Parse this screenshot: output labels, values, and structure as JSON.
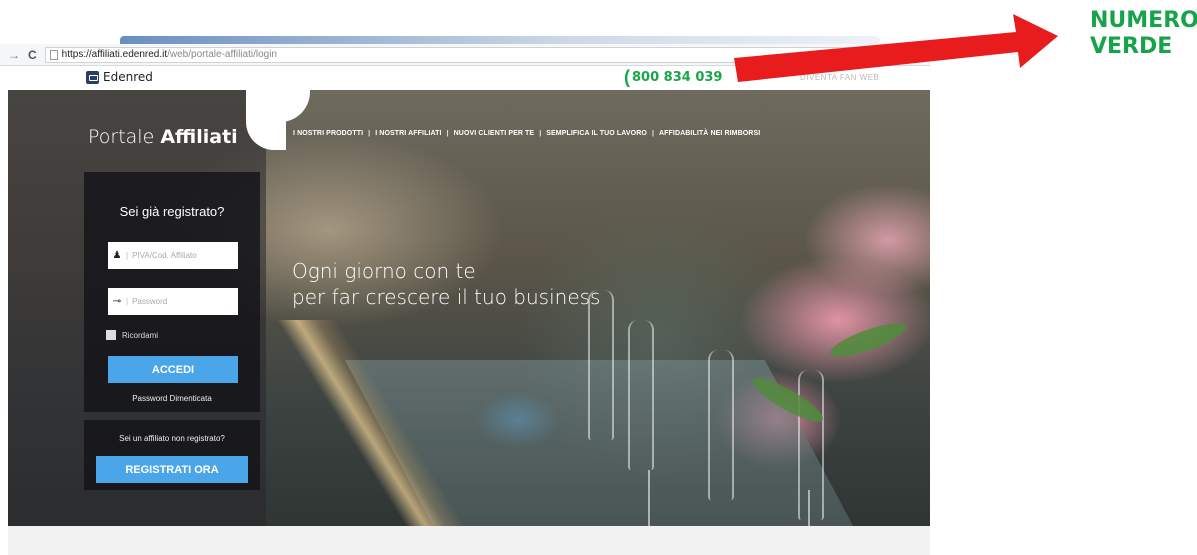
{
  "browser": {
    "url_host": "https://affiliati.edenred.it",
    "url_path": "/web/portale-affiliati/login"
  },
  "site": {
    "logo_text": "Edenred",
    "phone_number": "800 834 039",
    "phone_color": "#1aa54a",
    "faded_link": "DIVENTA FAN WEB"
  },
  "hero": {
    "brand_light": "Portale ",
    "brand_bold": "Affiliati",
    "nav_items": [
      "I NOSTRI PRODOTTI",
      "I NOSTRI AFFILIATI",
      "NUOVI CLIENTI PER TE",
      "SEMPLIFICA IL TUO LAVORO",
      "AFFIDABILITÀ NEI RIMBORSI"
    ],
    "headline_line1": "Ogni giorno con te",
    "headline_line2": "per far crescere il tuo business"
  },
  "login": {
    "title": "Sei già registrato?",
    "user_placeholder": "PIVA/Cod. Affiliato",
    "password_placeholder": "Password",
    "remember_label": "Ricordami",
    "submit_label": "ACCEDI",
    "forgot_label": "Password Dimenticata",
    "button_color": "#4aa6e8"
  },
  "register": {
    "prompt": "Sei un affiliato non registrato?",
    "button_label": "REGISTRATI ORA"
  },
  "annotation": {
    "line1": "NUMERO",
    "line2": "VERDE",
    "color": "#17a34a",
    "arrow_color": "#e81c1c"
  }
}
